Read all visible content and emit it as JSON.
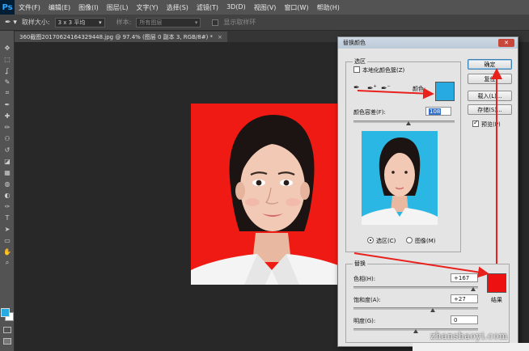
{
  "app": {
    "logo": "Ps"
  },
  "menu": [
    "文件(F)",
    "编辑(E)",
    "图像(I)",
    "图层(L)",
    "文字(Y)",
    "选择(S)",
    "滤镜(T)",
    "3D(D)",
    "视图(V)",
    "窗口(W)",
    "帮助(H)"
  ],
  "options": {
    "sample_size_label": "取样大小:",
    "sample_size_value": "3 x 3 平均",
    "sample_label": "样本:",
    "sample_value": "所有图层",
    "show_ring_label": "显示取样环"
  },
  "document_tab": {
    "title": "360截图20170624164329448.jpg @ 97.4% (图层 0 副本 3, RGB/8#) *",
    "close": "×"
  },
  "tools": [
    "move-icon",
    "marquee-icon",
    "lasso-icon",
    "quick-select-icon",
    "crop-icon",
    "eyedropper-icon",
    "healing-icon",
    "brush-icon",
    "stamp-icon",
    "history-brush-icon",
    "eraser-icon",
    "gradient-icon",
    "blur-icon",
    "dodge-icon",
    "pen-icon",
    "type-icon",
    "path-select-icon",
    "shape-icon",
    "hand-icon",
    "zoom-icon"
  ],
  "tool_glyphs": [
    "✥",
    "⬚",
    "ʆ",
    "✎",
    "⌗",
    "✒",
    "✚",
    "✏",
    "⚇",
    "↺",
    "◪",
    "▦",
    "◍",
    "◐",
    "✑",
    "T",
    "➤",
    "▭",
    "✋",
    "⌕"
  ],
  "colors": {
    "foreground": "#27a9e1",
    "background": "#ffffff",
    "photo_bg": "#ef1a14",
    "preview_bg": "#2ab7e3",
    "result": "#ee1111",
    "arrow": "#e8211d"
  },
  "dialog": {
    "title": "替换颜色",
    "close": "✕",
    "selection_group": "选区",
    "localized_clusters": "本地化颜色簇(Z)",
    "color_label": "颜色:",
    "tolerance_label": "颜色容差(F):",
    "tolerance_value": "108",
    "tolerance": 108,
    "radio_selection": "选区(C)",
    "radio_image": "图像(M)",
    "replace_group": "替换",
    "hue_label": "色相(H):",
    "hue_value": "+167",
    "hue": 167,
    "saturation_label": "饱和度(A):",
    "saturation_value": "+27",
    "saturation": 27,
    "lightness_label": "明度(G):",
    "lightness_value": "0",
    "lightness": 0,
    "result_label": "结果",
    "buttons": {
      "ok": "确定",
      "reset": "复位",
      "load": "载入(L)...",
      "save": "存储(S)..."
    },
    "preview_label": "预览(P)"
  },
  "watermark": "zhanshaoyi.com"
}
